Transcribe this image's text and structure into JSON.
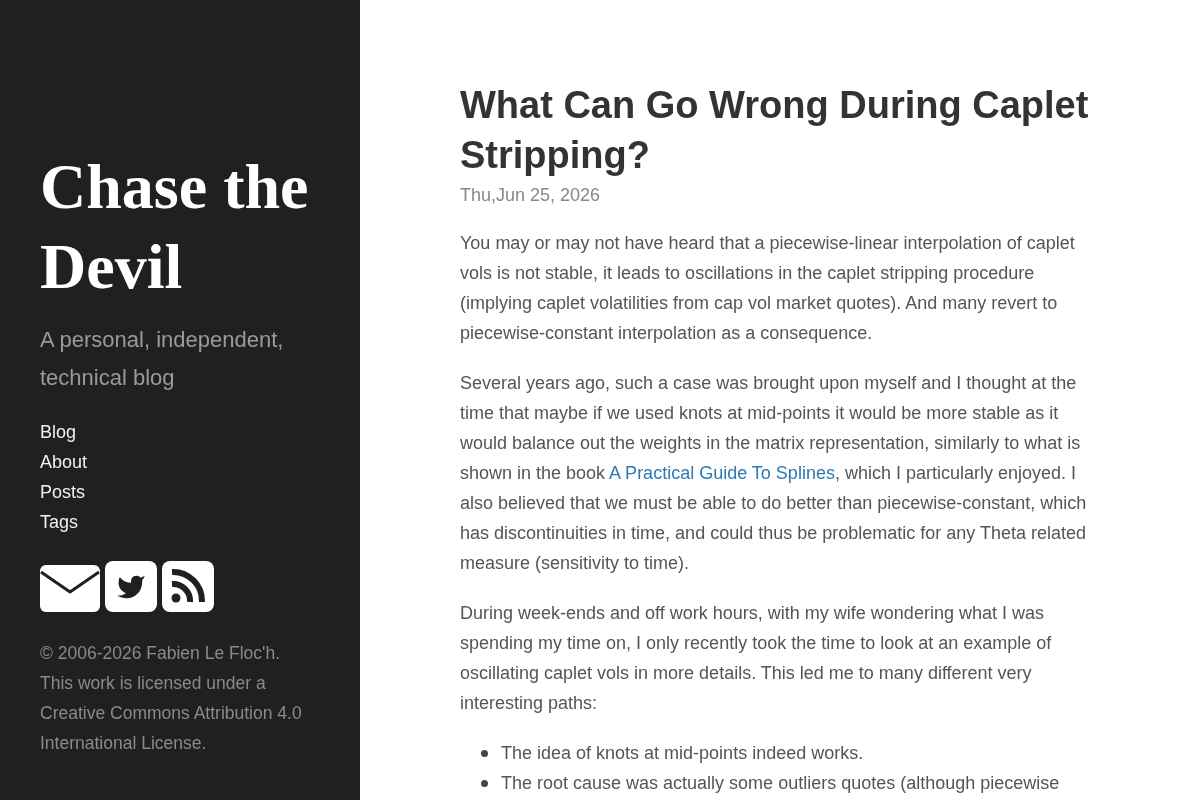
{
  "sidebar": {
    "site_title": "Chase the Devil",
    "tagline": "A personal, independent, technical blog",
    "nav": [
      "Blog",
      "About",
      "Posts",
      "Tags"
    ],
    "footer": "© 2006-2026 Fabien Le Floc'h. This work is licensed under a Creative Commons Attribution 4.0 International License."
  },
  "post": {
    "title": "What Can Go Wrong During Caplet Stripping?",
    "date": "Thu,Jun 25, 2026",
    "paragraphs": [
      {
        "segments": [
          {
            "kind": "text",
            "text": "You may or may not have heard that a piecewise-linear interpolation of caplet vols is not stable, it leads to oscillations in the caplet stripping procedure (implying caplet volatilities from cap vol market quotes). And many revert to piecewise-constant interpolation as a consequence."
          }
        ]
      },
      {
        "segments": [
          {
            "kind": "text",
            "text": "Several years ago, such a case was brought upon myself and I thought at the time that maybe if we used knots at mid-points it would be more stable as it would balance out the weights in the matrix representation, similarly to what is shown in the book "
          },
          {
            "kind": "link",
            "text": "A Practical Guide To Splines"
          },
          {
            "kind": "text",
            "text": ", which I particularly enjoyed. I also believed that we must be able to do better than piecewise-constant, which has discontinuities in time, and could thus be problematic for any Theta related measure (sensitivity to time)."
          }
        ]
      },
      {
        "segments": [
          {
            "kind": "text",
            "text": "During week-ends and off work hours, with my wife wondering what I was spending my time on, I only recently took the time to look at an example of oscillating caplet vols in more details. This led me to many different very interesting paths:"
          }
        ]
      }
    ],
    "bullets": [
      "The idea of knots at mid-points indeed works.",
      "The root cause was actually some outliers quotes (although piecewise"
    ]
  }
}
